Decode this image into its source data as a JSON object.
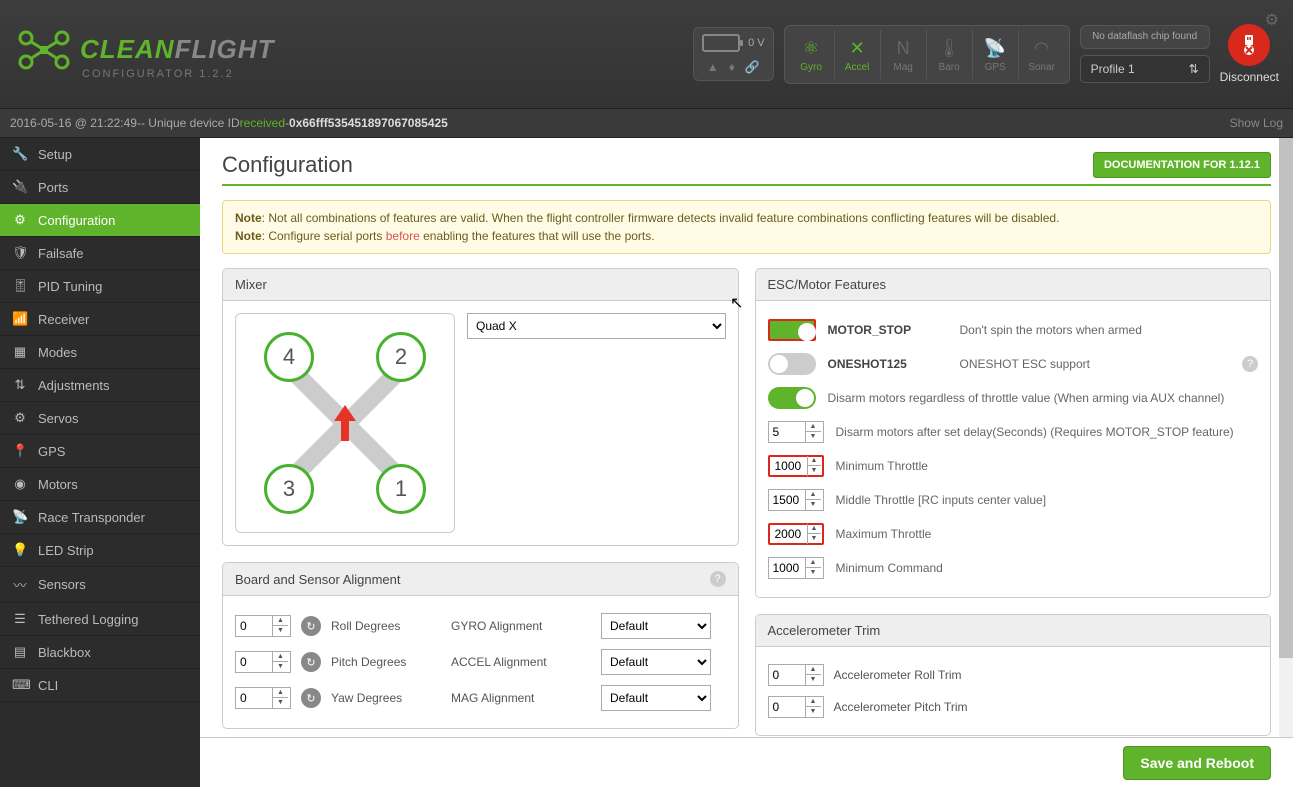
{
  "app": {
    "name_a": "CLEAN",
    "name_b": "FLIGHT",
    "sub": "CONFIGURATOR  1.2.2"
  },
  "battery": {
    "voltage": "0 V"
  },
  "sensors": [
    {
      "label": "Gyro",
      "on": true
    },
    {
      "label": "Accel",
      "on": true
    },
    {
      "label": "Mag",
      "on": false
    },
    {
      "label": "Baro",
      "on": false
    },
    {
      "label": "GPS",
      "on": false
    },
    {
      "label": "Sonar",
      "on": false
    }
  ],
  "dataflash": "No dataflash chip found",
  "profile": "Profile 1",
  "disconnect": "Disconnect",
  "status": {
    "ts": "2016-05-16 @ 21:22:49",
    "msg": " -- Unique device ID ",
    "recv": "received",
    "sep": " - ",
    "hex": "0x66fff535451897067085425"
  },
  "showlog": "Show Log",
  "sidebar": [
    {
      "label": "Setup",
      "icon": "🔧"
    },
    {
      "label": "Ports",
      "icon": "🔌"
    },
    {
      "label": "Configuration",
      "icon": "⚙",
      "active": true
    },
    {
      "label": "Failsafe",
      "icon": "🛡"
    },
    {
      "label": "PID Tuning",
      "icon": "🎚"
    },
    {
      "label": "Receiver",
      "icon": "📶"
    },
    {
      "label": "Modes",
      "icon": "▦"
    },
    {
      "label": "Adjustments",
      "icon": "⇅"
    },
    {
      "label": "Servos",
      "icon": "⚙"
    },
    {
      "label": "GPS",
      "icon": "📍"
    },
    {
      "label": "Motors",
      "icon": "◉"
    },
    {
      "label": "Race Transponder",
      "icon": "📡"
    },
    {
      "label": "LED Strip",
      "icon": "💡"
    },
    {
      "label": "Sensors",
      "icon": "〰"
    },
    {
      "label": "Tethered Logging",
      "icon": "☰"
    },
    {
      "label": "Blackbox",
      "icon": "▤"
    },
    {
      "label": "CLI",
      "icon": "⌨"
    }
  ],
  "page": {
    "title": "Configuration",
    "doc_btn": "DOCUMENTATION FOR 1.12.1"
  },
  "note": {
    "b": "Note",
    "l1": ": Not all combinations of features are valid. When the flight controller firmware detects invalid feature combinations conflicting features will be disabled.",
    "l2": ": Configure serial ports ",
    "link": "before",
    "l2b": " enabling the features that will use the ports."
  },
  "mixer": {
    "title": "Mixer",
    "sel": "Quad X",
    "motors": [
      "1",
      "2",
      "3",
      "4"
    ]
  },
  "esc": {
    "title": "ESC/Motor Features",
    "rows": [
      {
        "type": "toggle",
        "on": true,
        "label": "MOTOR_STOP",
        "desc": "Don't spin the motors when armed",
        "callout": "1",
        "red": true
      },
      {
        "type": "toggle",
        "on": false,
        "label": "ONESHOT125",
        "desc": "ONESHOT ESC support",
        "help": true
      },
      {
        "type": "toggle",
        "on": true,
        "desc": "Disarm motors regardless of throttle value (When arming via AUX channel)"
      },
      {
        "type": "num",
        "val": "5",
        "desc": "Disarm motors after set delay(Seconds) (Requires MOTOR_STOP feature)"
      },
      {
        "type": "num",
        "val": "1000",
        "desc": "Minimum Throttle",
        "callout": "2",
        "red": true
      },
      {
        "type": "num",
        "val": "1500",
        "desc": "Middle Throttle [RC inputs center value]"
      },
      {
        "type": "num",
        "val": "2000",
        "desc": "Maximum Throttle",
        "callout": "3",
        "red": true
      },
      {
        "type": "num",
        "val": "1000",
        "desc": "Minimum Command"
      }
    ]
  },
  "board": {
    "title": "Board and Sensor Alignment",
    "rows": [
      {
        "val": "0",
        "rot": "Roll Degrees",
        "al": "GYRO Alignment",
        "sel": "Default"
      },
      {
        "val": "0",
        "rot": "Pitch Degrees",
        "al": "ACCEL Alignment",
        "sel": "Default"
      },
      {
        "val": "0",
        "rot": "Yaw Degrees",
        "al": "MAG Alignment",
        "sel": "Default"
      }
    ]
  },
  "accel": {
    "title": "Accelerometer Trim",
    "rows": [
      {
        "val": "0",
        "desc": "Accelerometer Roll Trim"
      },
      {
        "val": "0",
        "desc": "Accelerometer Pitch Trim"
      }
    ]
  },
  "save": "Save and Reboot"
}
